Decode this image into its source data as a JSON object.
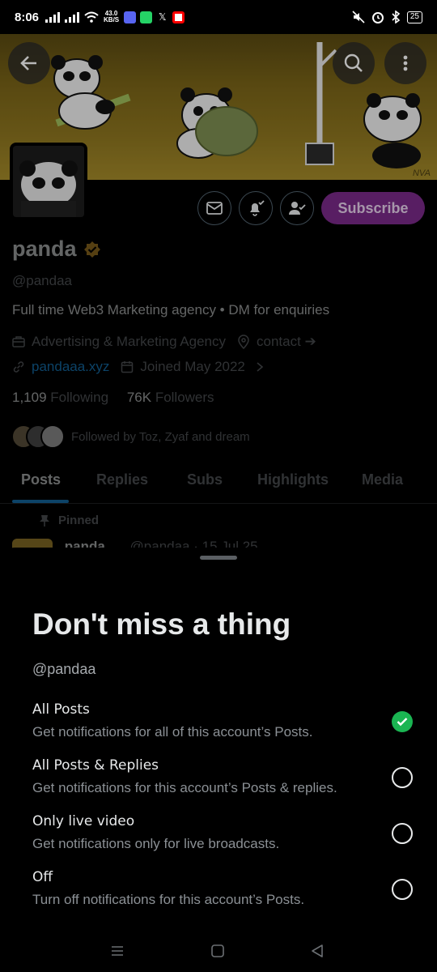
{
  "status": {
    "time": "8:06",
    "netspeed_value": "43.0",
    "netspeed_unit": "KB/S",
    "battery": "25"
  },
  "profile": {
    "name": "panda",
    "handle": "@pandaa",
    "bio": "Full time Web3 Marketing agency • DM for enquiries",
    "category": "Advertising & Marketing Agency",
    "contact": "contact ➔",
    "website": "pandaaa.xyz",
    "joined": "Joined May 2022",
    "following_count": "1,109",
    "following_label": "Following",
    "followers_count": "76K",
    "followers_label": "Followers",
    "followed_by": "Followed by Toz, Zyaf and dream",
    "subscribe_label": "Subscribe",
    "banner_signature": "NVA"
  },
  "tabs": [
    "Posts",
    "Replies",
    "Subs",
    "Highlights",
    "Media"
  ],
  "pinned": {
    "label": "Pinned",
    "peek_name": "panda",
    "peek_meta": "@pandaa · 15 Jul 25"
  },
  "sheet": {
    "title": "Don't miss a thing",
    "handle": "@pandaa",
    "options": [
      {
        "title": "All Posts",
        "desc": "Get notifications for all of this account’s Posts.",
        "selected": true
      },
      {
        "title": "All Posts & Replies",
        "desc": "Get notifications for this account’s Posts & replies.",
        "selected": false
      },
      {
        "title": "Only live video",
        "desc": "Get notifications only for live broadcasts.",
        "selected": false
      },
      {
        "title": "Off",
        "desc": "Turn off notifications for this account’s Posts.",
        "selected": false
      }
    ]
  },
  "colors": {
    "accent": "#1d9bf0",
    "subscribe": "#7b2a8a",
    "selected": "#1ab552",
    "verified": "#c7932a"
  }
}
